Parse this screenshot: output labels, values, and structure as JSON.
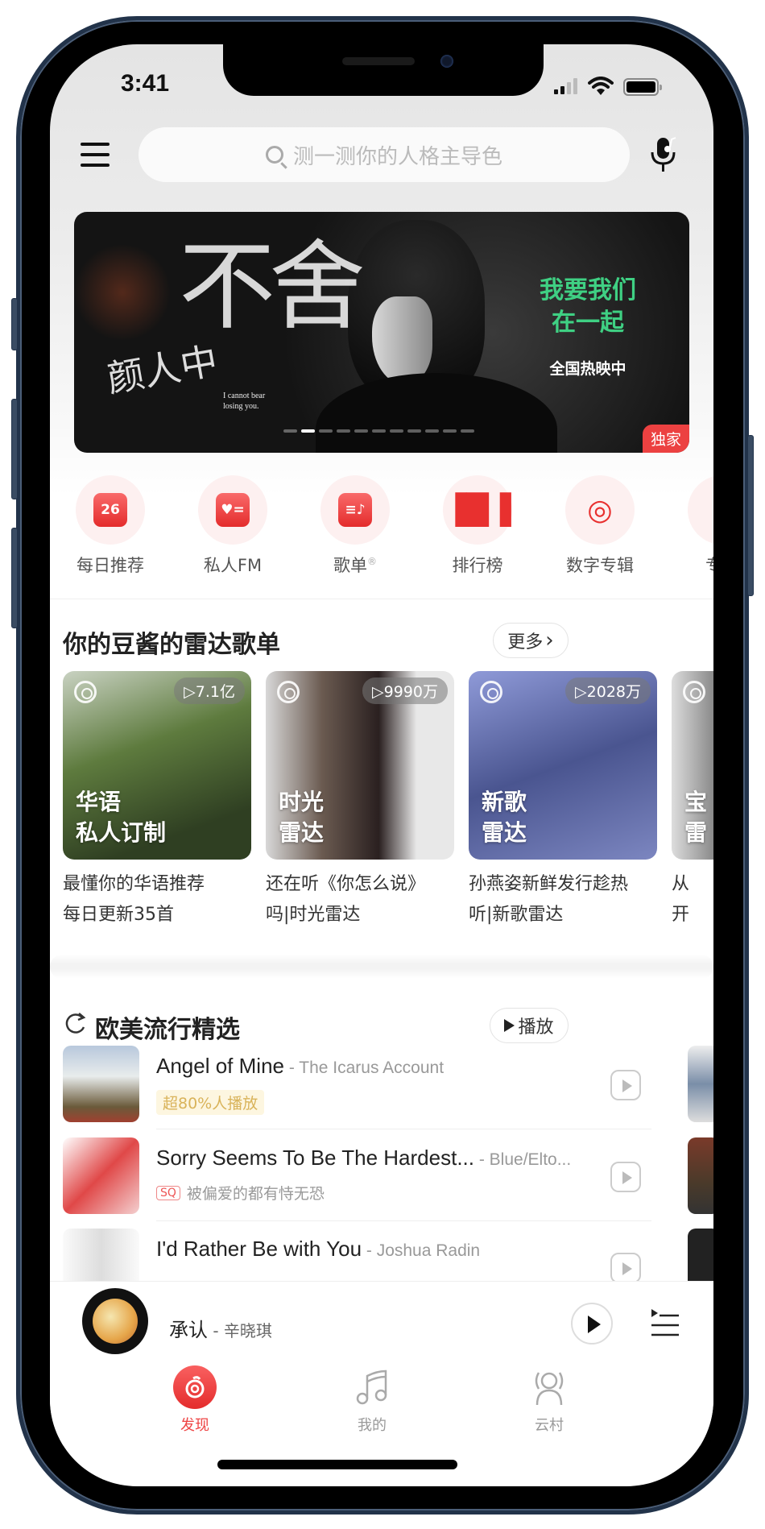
{
  "status_bar": {
    "time": "3:41",
    "signal_bars": 2,
    "signal_max": 4
  },
  "header": {
    "search_placeholder": "测一测你的人格主导色",
    "menu_icon": "menu-icon",
    "mic_icon": "mic-music-icon"
  },
  "banner": {
    "calligraphy_title": "不舍",
    "calligraphy_artist": "颜人中",
    "english_text": "I cannot bear losing you.",
    "movie_title_line1": "我要我们",
    "movie_title_line2": "在一起",
    "movie_subtitle": "全国热映中",
    "tag": "独家",
    "dot_count": 11,
    "active_dot": 2
  },
  "shortcuts": [
    {
      "label": "每日推荐",
      "icon": "calendar-icon",
      "glyph": "26"
    },
    {
      "label": "私人FM",
      "icon": "radio-icon",
      "glyph": "♥="
    },
    {
      "label": "歌单",
      "icon": "playlist-icon",
      "glyph": "≡♪",
      "sup": "®"
    },
    {
      "label": "排行榜",
      "icon": "chart-bars-icon",
      "glyph": "▐█▐"
    },
    {
      "label": "数字专辑",
      "icon": "digital-album-icon",
      "glyph": "◎"
    },
    {
      "label": "专注",
      "icon": "focus-icon",
      "glyph": "◗"
    }
  ],
  "radar": {
    "title": "你的豆酱的雷达歌单",
    "more_label": "更多",
    "more_chevron": "›",
    "cards": [
      {
        "plays": "▷7.1亿",
        "title_line1": "华语",
        "title_line2": "私人订制",
        "desc_line1": "最懂你的华语推荐",
        "desc_line2": "每日更新35首"
      },
      {
        "plays": "▷9990万",
        "title_line1": "时光",
        "title_line2": "雷达",
        "desc_line1": "还在听《你怎么说》",
        "desc_line2": "吗|时光雷达"
      },
      {
        "plays": "▷2028万",
        "title_line1": "新歌",
        "title_line2": "雷达",
        "desc_line1": "孙燕姿新鲜发行趁热",
        "desc_line2": "听|新歌雷达"
      },
      {
        "plays": "",
        "title_line1": "宝",
        "title_line2": "雷",
        "desc_line1": "从",
        "desc_line2": "开"
      }
    ]
  },
  "western": {
    "title": "欧美流行精选",
    "refresh_icon": "refresh-icon",
    "play_label": "播放",
    "songs": [
      {
        "title": "Angel of Mine",
        "artist": " - The Icarus Account",
        "badge": "超80%人播放",
        "sq": false,
        "subtitle": ""
      },
      {
        "title": "Sorry Seems To Be The Hardest...",
        "artist": " - Blue/Elto...",
        "badge": "",
        "sq": true,
        "sq_label": "SQ",
        "subtitle": "被偏爱的都有恃无恐"
      },
      {
        "title": "I'd Rather Be with You",
        "artist": " - Joshua Radin",
        "badge": "",
        "sq": false,
        "subtitle": ""
      }
    ]
  },
  "mini_player": {
    "song": "承认",
    "artist": " - 辛晓琪"
  },
  "tabs": [
    {
      "label": "发现",
      "icon": "netease-logo-icon",
      "active": true
    },
    {
      "label": "我的",
      "icon": "music-note-icon",
      "active": false
    },
    {
      "label": "云村",
      "icon": "community-icon",
      "active": false
    }
  ],
  "colors": {
    "accent": "#ec4141",
    "movie_green": "#3fd083",
    "badge_gold": "#d9b35a"
  }
}
